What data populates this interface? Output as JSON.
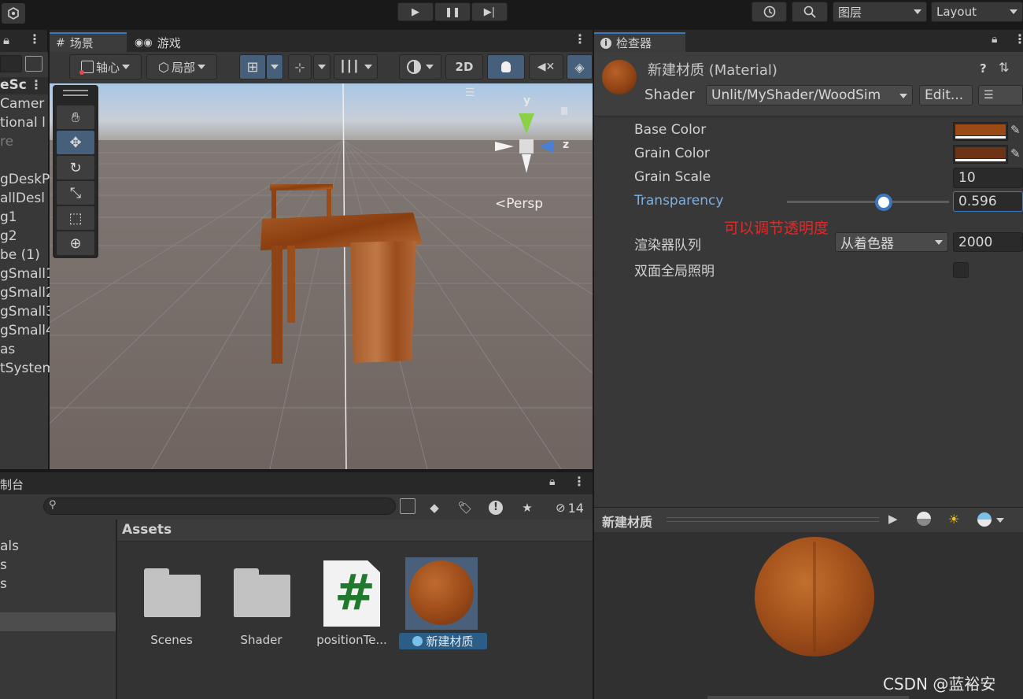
{
  "topbar": {
    "play": "▶",
    "pause": "❚❚",
    "step": "▶|",
    "history_icon": "history-icon",
    "search_icon": "search-icon",
    "layers_label": "图层",
    "layout_label": "Layout"
  },
  "scene": {
    "tab_scene": "场景",
    "tab_game": "游戏",
    "pivot_label": "轴心",
    "local_label": "局部",
    "btn_2d": "2D",
    "persp_label": "<Persp",
    "axis_y": "y",
    "axis_z": "z"
  },
  "hierarchy": {
    "items": [
      "eSc",
      "Camer",
      "tional l",
      "re",
      "gDeskP",
      "allDesl",
      "g1",
      "g2",
      "be (1)",
      "gSmall1",
      "gSmall2",
      "gSmall3",
      "gSmall4",
      "as",
      "tSystem"
    ]
  },
  "project": {
    "tab": "制台",
    "left_items": [
      "als",
      "s",
      "s"
    ],
    "assets_header": "Assets",
    "hidden_count": "14",
    "assets": [
      {
        "name": "Scenes",
        "type": "folder"
      },
      {
        "name": "Shader",
        "type": "folder"
      },
      {
        "name": "positionTe...",
        "type": "script"
      },
      {
        "name": "新建材质",
        "type": "material"
      }
    ]
  },
  "inspector": {
    "tab": "检查器",
    "title": "新建材质 (Material)",
    "shader_label": "Shader",
    "shader_value": "Unlit/MyShader/WoodSim",
    "edit_label": "Edit...",
    "properties": {
      "base_color_label": "Base Color",
      "grain_color_label": "Grain Color",
      "grain_scale_label": "Grain Scale",
      "grain_scale_value": "10",
      "transparency_label": "Transparency",
      "transparency_value": "0.596",
      "render_queue_label": "渲染器队列",
      "render_queue_option": "从着色器",
      "render_queue_value": "2000",
      "double_gi_label": "双面全局照明"
    },
    "annotation": "可以调节透明度",
    "preview_title": "新建材质",
    "transparency_fraction": 0.596,
    "colors": {
      "base_color": "#9a4a14",
      "grain_color": "#6e3214",
      "annotation": "#e02a2a",
      "accent": "#3a79bb"
    }
  },
  "watermark": "CSDN @蓝裕安"
}
